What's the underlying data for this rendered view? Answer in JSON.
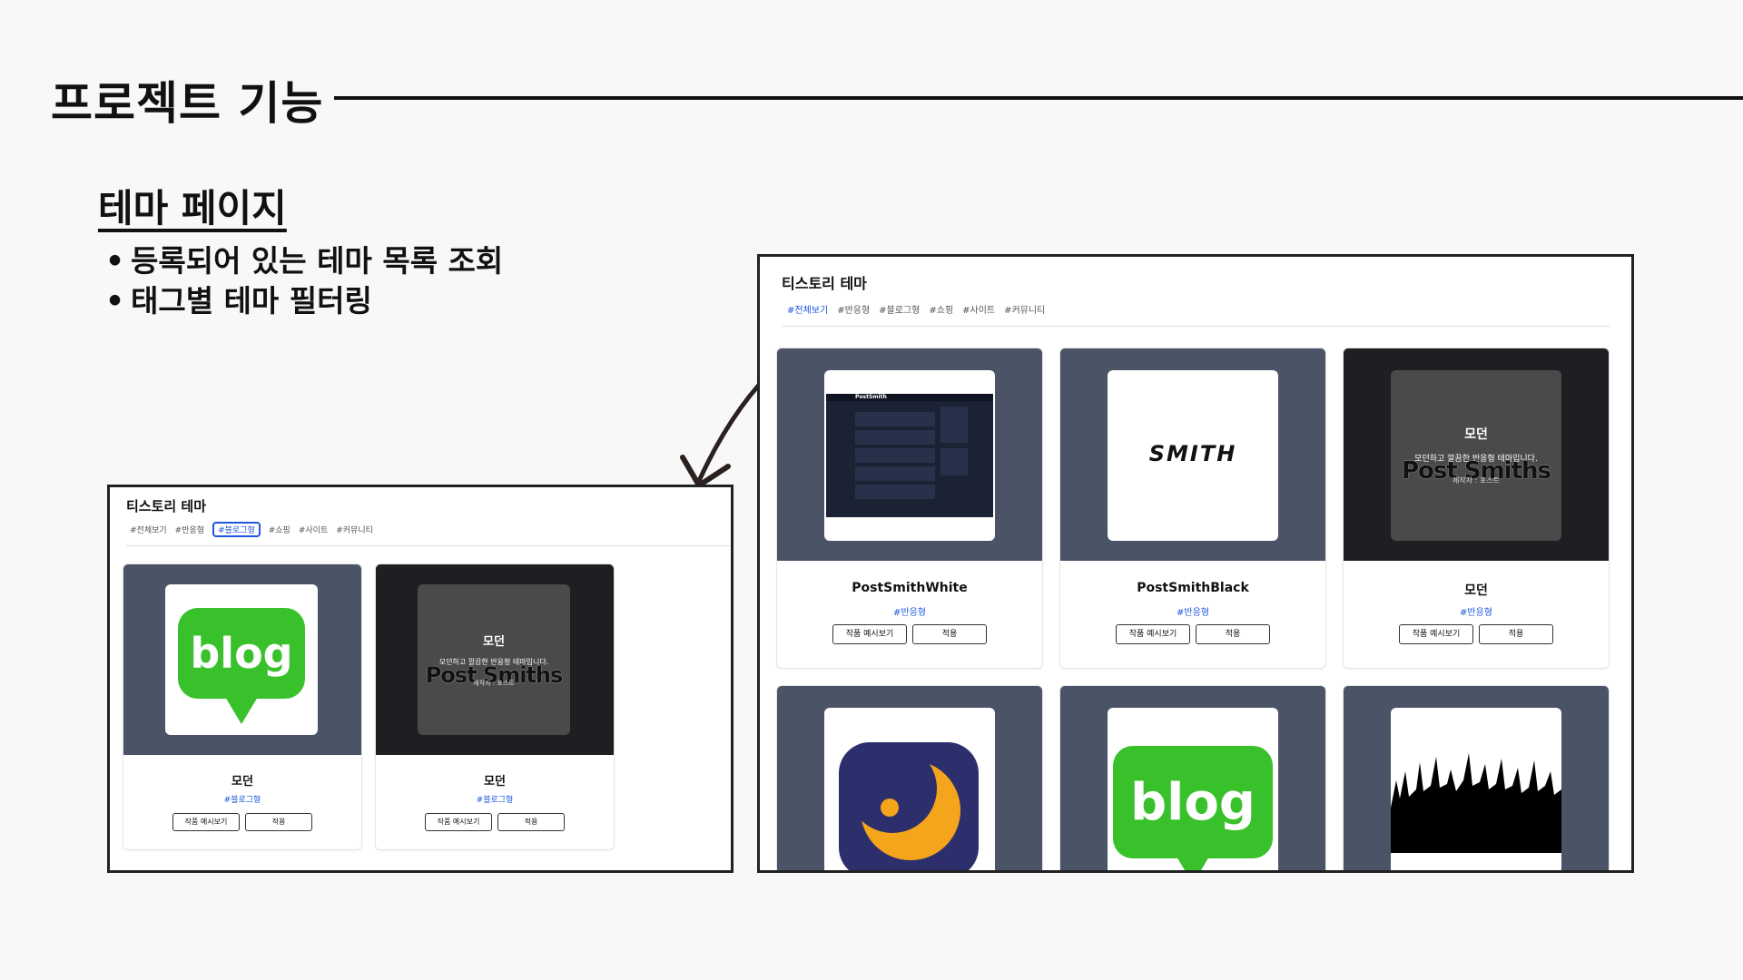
{
  "header": {
    "title": "프로젝트 기능"
  },
  "section": {
    "title": "테마 페이지",
    "bullets": [
      "등록되어 있는 테마 목록 조회",
      "태그별 테마 필터링"
    ]
  },
  "small_screenshot": {
    "title": "티스토리 테마",
    "tags": [
      "#전체보기",
      "#반응형",
      "#블로그형",
      "#쇼핑",
      "#사이트",
      "#커뮤니티"
    ],
    "active_tag": "#블로그형",
    "cards": [
      {
        "name": "모던",
        "tag": "#블로그형",
        "preview_label": "작품 예시보기",
        "apply_label": "적용",
        "thumb": "blog"
      },
      {
        "name": "모던",
        "tag": "#블로그형",
        "preview_label": "작품 예시보기",
        "apply_label": "적용",
        "thumb": "dark",
        "thumb_title": "모던",
        "thumb_desc": "모던하고 깔끔한 반응형 테마입니다.",
        "thumb_big": "Post Smiths",
        "thumb_small": "제작자 : 포스트"
      }
    ]
  },
  "large_screenshot": {
    "title": "티스토리 테마",
    "tags": [
      "#전체보기",
      "#반응형",
      "#블로그형",
      "#쇼핑",
      "#사이트",
      "#커뮤니티"
    ],
    "active_tag": "#전체보기",
    "cards": [
      {
        "name": "PostSmithWhite",
        "tag": "#반응형",
        "preview_label": "작품 예시보기",
        "apply_label": "적용",
        "thumb": "postsmith-dark",
        "thumb_brand": "PostSmith"
      },
      {
        "name": "PostSmithBlack",
        "tag": "#반응형",
        "preview_label": "작품 예시보기",
        "apply_label": "적용",
        "thumb": "smith",
        "thumb_logo": "SMITH"
      },
      {
        "name": "모던",
        "tag": "#반응형",
        "preview_label": "작품 예시보기",
        "apply_label": "적용",
        "thumb": "dark",
        "thumb_title": "모던",
        "thumb_desc": "모던하고 깔끔한 반응형 테마입니다.",
        "thumb_big": "Post Smiths",
        "thumb_small": "제작자 : 포스트"
      },
      {
        "thumb": "moon"
      },
      {
        "thumb": "blog"
      },
      {
        "thumb": "crowd"
      }
    ]
  },
  "blog_logo_text": "blog",
  "colors": {
    "accent": "#1f56e0",
    "blog_green": "#39c12c",
    "card_header": "#4a5466",
    "moon_bg": "#2c2f6b",
    "moon": "#f5a51b"
  }
}
